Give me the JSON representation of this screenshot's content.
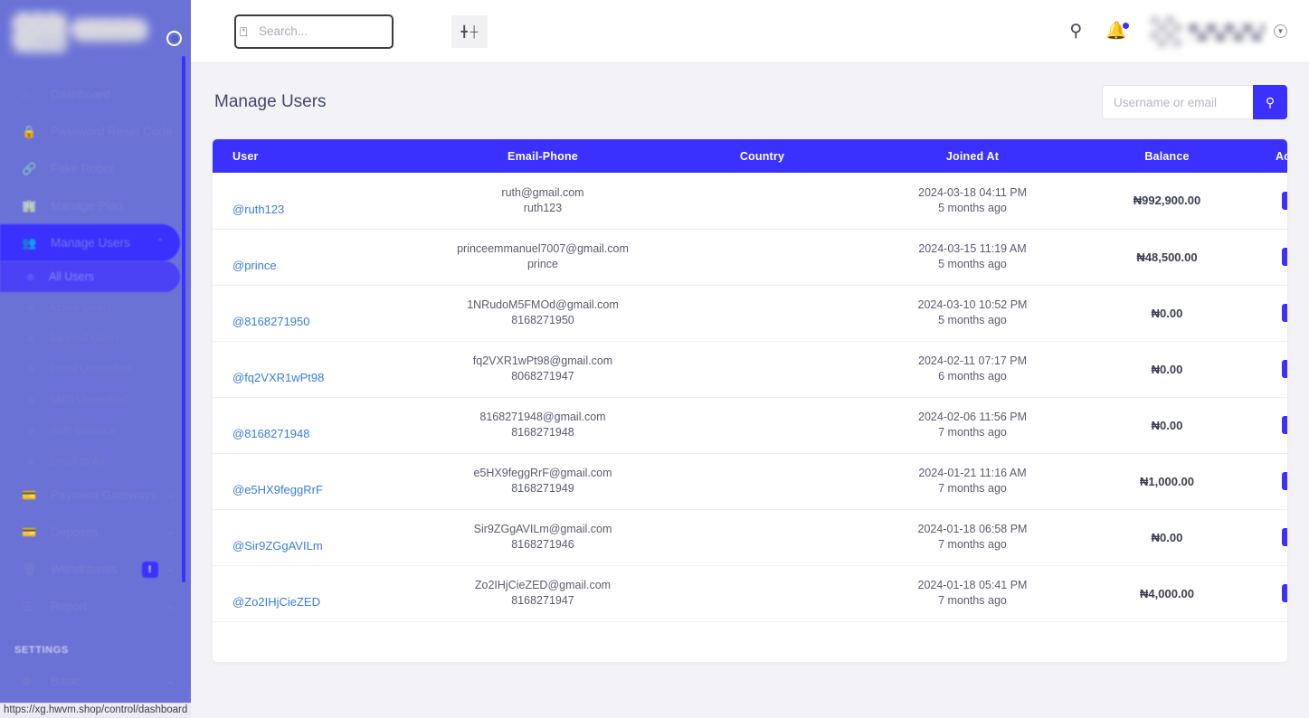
{
  "sidebar": {
    "brand_sub": "YOUXDANYUANMARU",
    "toggle_icon": "circle-toggle-icon",
    "items": [
      {
        "label": "Dashboard",
        "icon": "home-icon",
        "caret": ""
      },
      {
        "label": "Password Reset Code",
        "icon": "lock-icon",
        "caret": ""
      },
      {
        "label": "Fake Robot",
        "icon": "link-icon",
        "caret": ""
      },
      {
        "label": "Manage Plan",
        "icon": "building-icon",
        "caret": ""
      },
      {
        "label": "Manage Users",
        "icon": "users-icon",
        "caret": "⌃"
      }
    ],
    "submenu": [
      {
        "label": "All Users",
        "icon": "dot-circle-icon"
      },
      {
        "label": "Active Users",
        "icon": "dot-circle-icon"
      },
      {
        "label": "Banned Users",
        "icon": "dot-circle-icon"
      },
      {
        "label": "Email Unverified",
        "icon": "dot-circle-icon"
      },
      {
        "label": "SMS Unverified",
        "icon": "dot-circle-icon"
      },
      {
        "label": "With Balance",
        "icon": "dot-circle-icon"
      },
      {
        "label": "Email to All",
        "icon": "dot-circle-icon"
      }
    ],
    "items_after": [
      {
        "label": "Payment Gateways",
        "icon": "card-icon",
        "caret": "⌄",
        "badge": ""
      },
      {
        "label": "Deposits",
        "icon": "card-icon",
        "caret": "⌄",
        "badge": ""
      },
      {
        "label": "Withdrawals",
        "icon": "trash-icon",
        "caret": "⌄",
        "badge": "!"
      },
      {
        "label": "Report",
        "icon": "list-icon",
        "caret": "⌄",
        "badge": ""
      }
    ],
    "group_title": "SETTINGS",
    "items_settings": [
      {
        "label": "Basic",
        "icon": "gear-icon",
        "caret": "⌄"
      }
    ]
  },
  "statusbar": {
    "url": "https://xg.hwvm.shop/control/dashboard"
  },
  "topbar": {
    "search_placeholder": "Search...",
    "search_value": "",
    "search_icon": "search-slash-icon",
    "tool_icons": [
      "expand-icon",
      "collapse-icon"
    ],
    "right_icons": [
      "search-icon",
      "bell-icon"
    ],
    "profile_chevron": "chevron-down-icon"
  },
  "page": {
    "title": "Manage Users",
    "search_placeholder": "Username or email",
    "search_value": "",
    "search_button_icon": "search-icon"
  },
  "table": {
    "columns": [
      "User",
      "Email-Phone",
      "Country",
      "Joined At",
      "Balance",
      "Action"
    ],
    "action_icon": "monitor-icon",
    "rows": [
      {
        "user": "@ruth123",
        "email": "ruth@gmail.com",
        "phone": "ruth123",
        "country": "",
        "joined_at": "2024-03-18 04:11 PM",
        "joined_ago": "5 months ago",
        "balance": "₦992,900.00"
      },
      {
        "user": "@prince",
        "email": "princeemmanuel7007@gmail.com",
        "phone": "prince",
        "country": "",
        "joined_at": "2024-03-15 11:19 AM",
        "joined_ago": "5 months ago",
        "balance": "₦48,500.00"
      },
      {
        "user": "@8168271950",
        "email": "1NRudoM5FMOd@gmail.com",
        "phone": "8168271950",
        "country": "",
        "joined_at": "2024-03-10 10:52 PM",
        "joined_ago": "5 months ago",
        "balance": "₦0.00"
      },
      {
        "user": "@fq2VXR1wPt98",
        "email": "fq2VXR1wPt98@gmail.com",
        "phone": "8068271947",
        "country": "",
        "joined_at": "2024-02-11 07:17 PM",
        "joined_ago": "6 months ago",
        "balance": "₦0.00"
      },
      {
        "user": "@8168271948",
        "email": "8168271948@gmail.com",
        "phone": "8168271948",
        "country": "",
        "joined_at": "2024-02-06 11:56 PM",
        "joined_ago": "7 months ago",
        "balance": "₦0.00"
      },
      {
        "user": "@e5HX9feggRrF",
        "email": "e5HX9feggRrF@gmail.com",
        "phone": "8168271949",
        "country": "",
        "joined_at": "2024-01-21 11:16 AM",
        "joined_ago": "7 months ago",
        "balance": "₦1,000.00"
      },
      {
        "user": "@Sir9ZGgAVILm",
        "email": "Sir9ZGgAVILm@gmail.com",
        "phone": "8168271946",
        "country": "",
        "joined_at": "2024-01-18 06:58 PM",
        "joined_ago": "7 months ago",
        "balance": "₦0.00"
      },
      {
        "user": "@Zo2IHjCieZED",
        "email": "Zo2IHjCieZED@gmail.com",
        "phone": "8168271947",
        "country": "",
        "joined_at": "2024-01-18 05:41 PM",
        "joined_ago": "7 months ago",
        "balance": "₦4,000.00"
      }
    ]
  },
  "colors": {
    "accent": "#3b31ff",
    "sidebar_bg": "#6b72d6",
    "page_bg": "#f2f2f7",
    "link": "#3b7ddd"
  }
}
